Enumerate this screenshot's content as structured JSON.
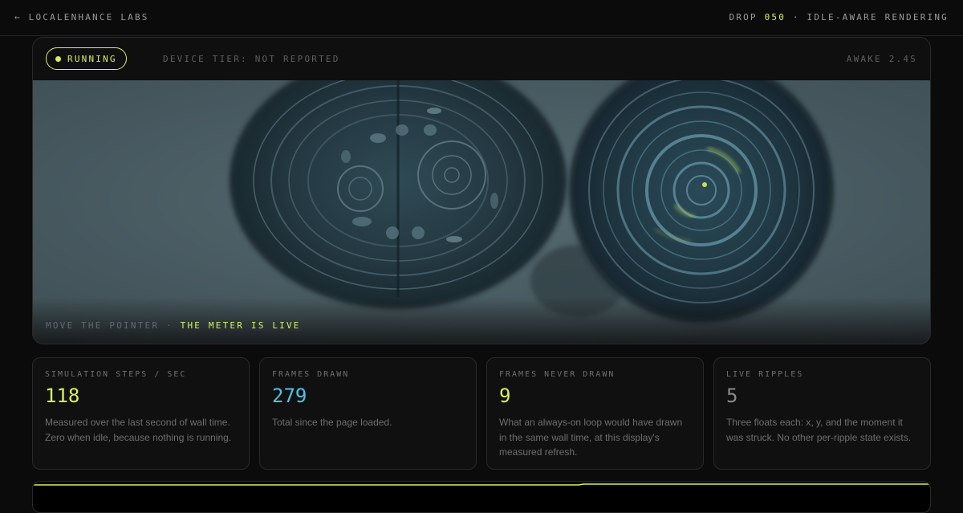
{
  "topbar": {
    "back_label": "← LocalEnhance Labs",
    "drop_prefix": "Drop",
    "drop_number": "050",
    "drop_suffix": "· Idle-aware rendering"
  },
  "stage": {
    "status": "Running",
    "device_tier": "Device tier: not reported",
    "awake": "Awake 2.4s",
    "caption_prefix": "Move the pointer ·",
    "caption_live": "The meter is live"
  },
  "stats": [
    {
      "label": "Simulation steps / sec",
      "value": "118",
      "color": "#d6f25a",
      "description": "Measured over the last second of wall time. Zero when idle, because nothing is running."
    },
    {
      "label": "Frames drawn",
      "value": "279",
      "color": "#4fc3e8",
      "description": "Total since the page loaded."
    },
    {
      "label": "Frames never drawn",
      "value": "9",
      "color": "#d6f25a",
      "description": "What an always-on loop would have drawn in the same wall time, at this display's measured refresh."
    },
    {
      "label": "Live ripples",
      "value": "5",
      "color": "#8a8a8a",
      "description": "Three floats each: x, y, and the moment it was struck. No other per-ripple state exists."
    }
  ],
  "colors": {
    "accent": "#d6f25a",
    "cyan": "#4fc3e8",
    "canvas": "#4a5b61"
  }
}
